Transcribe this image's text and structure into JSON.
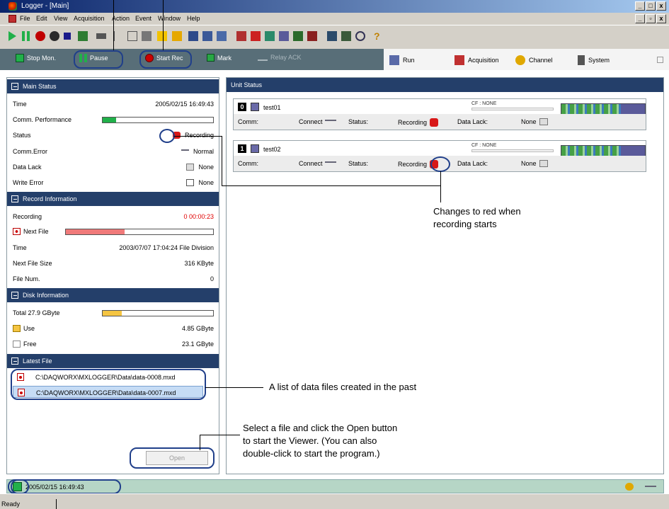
{
  "window": {
    "title": "Logger - [Main]",
    "min": "_",
    "max": "□",
    "close": "x",
    "restore": "▫"
  },
  "menu": [
    "File",
    "Edit",
    "View",
    "Acquisition",
    "Action",
    "Event",
    "Window",
    "Help"
  ],
  "commands": {
    "stop_mon": "Stop Mon.",
    "pause": "Pause",
    "start_rec": "Start Rec",
    "mark": "Mark",
    "relay_ack": "Relay ACK"
  },
  "tabs": [
    "Run",
    "Acquisition",
    "Channel",
    "System"
  ],
  "main_status": {
    "header": "Main Status",
    "time_label": "Time",
    "time_value": "2005/02/15 16:49:43",
    "comm_perf_label": "Comm. Performance",
    "comm_perf_fraction": 0.12,
    "status_label": "Status",
    "status_value": "Recording",
    "comm_error_label": "Comm.Error",
    "comm_error_value": "Normal",
    "data_lack_label": "Data Lack",
    "data_lack_value": "None",
    "write_error_label": "Write Error",
    "write_error_value": "None"
  },
  "record_info": {
    "header": "Record Information",
    "recording_label": "Recording",
    "recording_value": "0 00:00:23",
    "next_file_label": "Next File",
    "next_file_fraction": 0.4,
    "time_label": "Time",
    "time_value": "2003/07/07 17:04:24 File Division",
    "next_size_label": "Next File Size",
    "next_size_value": "316 KByte",
    "file_num_label": "File Num.",
    "file_num_value": "0"
  },
  "disk_info": {
    "header": "Disk Information",
    "total_label": "Total 27.9 GByte",
    "use_fraction": 0.17,
    "use_label": "Use",
    "use_value": "4.85 GByte",
    "free_label": "Free",
    "free_value": "23.1 GByte"
  },
  "latest_file": {
    "header": "Latest File",
    "files": [
      "C:\\DAQWORX\\MXLOGGER\\Data\\data-0008.mxd",
      "C:\\DAQWORX\\MXLOGGER\\Data\\data-0007.mxd"
    ],
    "open_button": "Open"
  },
  "unit_status": {
    "header": "Unit Status",
    "units": [
      {
        "num": "0",
        "name": "test01",
        "cf": "CF : NONE",
        "comm_label": "Comm:",
        "connect": "Connect",
        "status_label": "Status:",
        "status": "Recording",
        "lack_label": "Data Lack:",
        "lack": "None"
      },
      {
        "num": "1",
        "name": "test02",
        "cf": "CF : NONE",
        "comm_label": "Comm:",
        "connect": "Connect",
        "status_label": "Status:",
        "status": "Recording",
        "lack_label": "Data Lack:",
        "lack": "None"
      }
    ]
  },
  "bottom": {
    "timestamp": "2005/02/15 16:49:43",
    "ready": "Ready"
  },
  "annotations": {
    "red_when_recording": [
      "Changes to red when",
      "recording starts"
    ],
    "file_list": "A list of data files created in the past",
    "open_hint": [
      "Select a file and click the Open button",
      "to start the Viewer. (You can also",
      "double-click to start the program.)"
    ]
  },
  "colors": {
    "header_bg": "#243f6a",
    "cmd_bg": "#586e78",
    "record_red": "#d81818",
    "accent_green": "#21b04a",
    "disk_yellow": "#f5c542",
    "nextfile_pink": "#f07a7a"
  }
}
